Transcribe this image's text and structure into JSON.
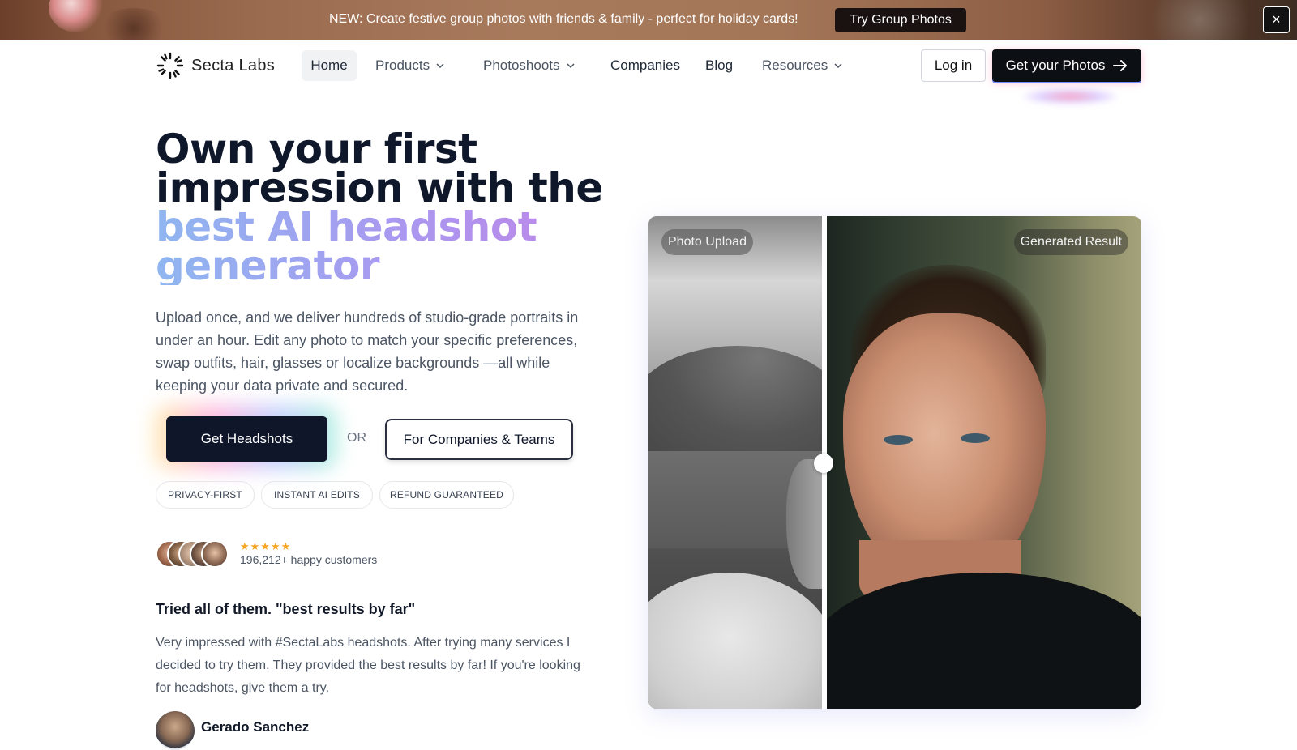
{
  "banner": {
    "text": "NEW: Create festive group photos with friends & family - perfect for holiday cards!",
    "cta_label": "Try Group Photos",
    "close_label": "×"
  },
  "nav": {
    "brand": "Secta Labs",
    "items": [
      {
        "label": "Home"
      },
      {
        "label": "Products"
      },
      {
        "label": "Photoshoots"
      },
      {
        "label": "Companies"
      },
      {
        "label": "Blog"
      },
      {
        "label": "Resources"
      }
    ],
    "login_label": "Log in",
    "cta_label": "Get your Photos"
  },
  "hero": {
    "headline_line1": "Own your first",
    "headline_line2": "impression with the",
    "headline_highlight1": "best AI headshot",
    "headline_highlight2": "generator",
    "subtext": "Upload once, and we deliver hundreds of studio-grade portraits in under an hour. Edit any photo to match your specific preferences, swap outfits, hair, glasses or localize backgrounds —all while keeping your data private and secured.",
    "primary_cta": "Get Headshots",
    "or_text": "OR",
    "secondary_cta": "For Companies & Teams",
    "pills": [
      "PRIVACY-FIRST",
      "INSTANT AI EDITS",
      "REFUND GUARANTEED"
    ],
    "rating_stars": "★★★★★",
    "happy_customers": "196,212+ happy customers"
  },
  "testimonial": {
    "title": "Tried all of them. \"best results by far\"",
    "body": "Very impressed with #SectaLabs headshots. After trying many services I decided to try them. They provided the best results by far! If you're looking for headshots, give them a try.",
    "reviewer": "Gerado Sanchez"
  },
  "compare": {
    "left_label": "Photo Upload",
    "right_label": "Generated Result"
  },
  "colors": {
    "dark": "#0f1629",
    "headline_gradient_start": "#8fb6f0",
    "headline_gradient_end": "#c084e8",
    "star": "#f5a623"
  }
}
